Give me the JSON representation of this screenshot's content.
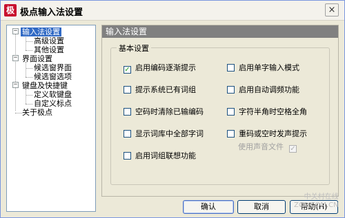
{
  "window": {
    "title": "极点输入法设置",
    "close_glyph": "×",
    "app_glyph": "极"
  },
  "tree": {
    "items": [
      {
        "label": "输入法设置",
        "expander": "−"
      },
      {
        "label": "高级设置"
      },
      {
        "label": "其他设置"
      },
      {
        "label": "界面设置",
        "expander": "−"
      },
      {
        "label": "候选窗界面"
      },
      {
        "label": "候选窗选项"
      },
      {
        "label": "键盘及快捷键",
        "expander": "−"
      },
      {
        "label": "定义软键盘"
      },
      {
        "label": "自定义标点"
      },
      {
        "label": "关于极点"
      }
    ]
  },
  "panel": {
    "header": "输入法设置",
    "group_title": "基本设置",
    "options": [
      {
        "label": "启用编码逐渐提示",
        "checked": true
      },
      {
        "label": "启用单字输入模式",
        "checked": false
      },
      {
        "label": "提示系统已有词组",
        "checked": false
      },
      {
        "label": "启用自动调频功能",
        "checked": false
      },
      {
        "label": "空码时清除已输编码",
        "checked": false
      },
      {
        "label": "字符半角时空格全角",
        "checked": false
      },
      {
        "label": "显示词库中全部字词",
        "checked": false
      },
      {
        "label": "重码或空时发声提示",
        "checked": false
      },
      {
        "label": "启用词组联想功能",
        "checked": false
      },
      {
        "label": "使用声音文件",
        "checked": true,
        "disabled": true
      }
    ]
  },
  "buttons": {
    "ok": "确认",
    "cancel": "取消",
    "help": "帮助(H)"
  },
  "watermark": {
    "line1": "中关村在线",
    "line2": "ZOL.COM.CN"
  },
  "colors": {
    "selection": "#316ac5",
    "panel_header": "#808080",
    "check": "#21a121"
  }
}
